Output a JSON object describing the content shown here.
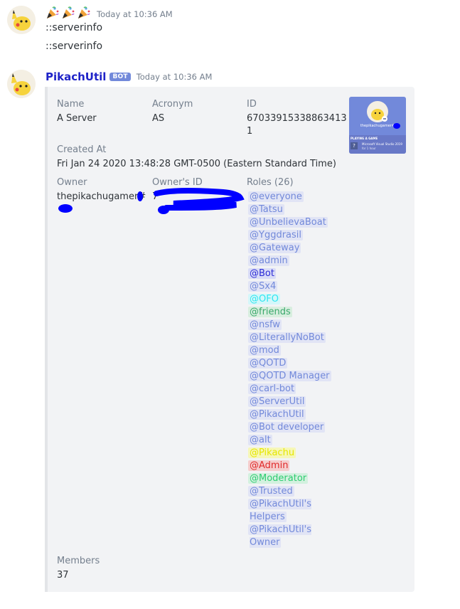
{
  "messages": [
    {
      "author_badges": [
        "party-popper-icon",
        "party-popper-icon",
        "party-popper-icon"
      ],
      "timestamp": "Today at 10:36 AM",
      "lines": [
        "::serverinfo",
        "::serverinfo"
      ]
    },
    {
      "author": "PikachUtil",
      "bot_tag": "BOT",
      "timestamp": "Today at 10:36 AM"
    }
  ],
  "embed": {
    "fields": {
      "name": {
        "label": "Name",
        "value": "A Server"
      },
      "acronym": {
        "label": "Acronym",
        "value": "AS"
      },
      "id": {
        "label": "ID",
        "value_line1": "67033915338863413",
        "value_line2": "1"
      },
      "created_at": {
        "label": "Created At",
        "value": "Fri Jan 24 2020 13:48:28 GMT-0500 (Eastern Standard Time)"
      },
      "owner": {
        "label": "Owner",
        "value": "thepikachugamer#"
      },
      "owner_id": {
        "label": "Owner's ID",
        "value": "7"
      },
      "roles": {
        "label": "Roles (26)"
      },
      "members": {
        "label": "Members",
        "value": "37"
      }
    },
    "roles": [
      {
        "text": "@everyone",
        "color": "#7289da",
        "bg": "#e1e4f5"
      },
      {
        "text": "@Tatsu",
        "color": "#7289da",
        "bg": "#e1e4f5"
      },
      {
        "text": "@UnbelievaBoat",
        "color": "#7289da",
        "bg": "#e1e4f5"
      },
      {
        "text": "@Yggdrasil",
        "color": "#7289da",
        "bg": "#e1e4f5"
      },
      {
        "text": "@Gateway",
        "color": "#7289da",
        "bg": "#e1e4f5"
      },
      {
        "text": "@admin",
        "color": "#7289da",
        "bg": "#e1e4f5"
      },
      {
        "text": "@Bot",
        "color": "#2b2bd6",
        "bg": "#d9dcf7"
      },
      {
        "text": "@Sx4",
        "color": "#7289da",
        "bg": "#e1e4f5"
      },
      {
        "text": "@OFO",
        "color": "#2ee6f0",
        "bg": "#d4f7fa"
      },
      {
        "text": "@friends",
        "color": "#3aa86b",
        "bg": "#d8eedf"
      },
      {
        "text": "@nsfw",
        "color": "#7289da",
        "bg": "#e1e4f5"
      },
      {
        "text": "@LiterallyNoBot",
        "color": "#7289da",
        "bg": "#e1e4f5"
      },
      {
        "text": "@mod",
        "color": "#7289da",
        "bg": "#e1e4f5"
      },
      {
        "text": "@QOTD",
        "color": "#7289da",
        "bg": "#e1e4f5"
      },
      {
        "text": "@QOTD Manager",
        "color": "#7289da",
        "bg": "#e1e4f5"
      },
      {
        "text": "@carl-bot",
        "color": "#7289da",
        "bg": "#e1e4f5"
      },
      {
        "text": "@ServerUtil",
        "color": "#7289da",
        "bg": "#e1e4f5"
      },
      {
        "text": "@PikachUtil",
        "color": "#7289da",
        "bg": "#e1e4f5"
      },
      {
        "text": "@Bot developer",
        "color": "#7289da",
        "bg": "#e1e4f5"
      },
      {
        "text": "@alt",
        "color": "#7289da",
        "bg": "#e1e4f5"
      },
      {
        "text": "@Pikachu",
        "color": "#e6e600",
        "bg": "#f6f7b8"
      },
      {
        "text": "@Admin",
        "color": "#e02a2a",
        "bg": "#f5cdcd"
      },
      {
        "text": "@Moderator",
        "color": "#2ecc71",
        "bg": "#d3f1df"
      },
      {
        "text": "@Trusted",
        "color": "#7289da",
        "bg": "#e1e4f5"
      },
      {
        "text": "@PikachUtil's Helpers",
        "color": "#7289da",
        "bg": "#e1e4f5",
        "wrap": true
      },
      {
        "text": "@PikachUtil's Owner",
        "color": "#7289da",
        "bg": "#e1e4f5",
        "wrap": true
      }
    ],
    "thumbnail": {
      "username": "thepikachugamer#",
      "activity_heading": "PLAYING A GAME",
      "app_name": "Microsoft Visual Studio 2019",
      "elapsed": "for 1 hour"
    }
  },
  "colors": {
    "username": "#1f23c8",
    "bot_tag_bg": "#7289da",
    "embed_bg": "#f2f3f5",
    "scribble": "#0000ff"
  }
}
